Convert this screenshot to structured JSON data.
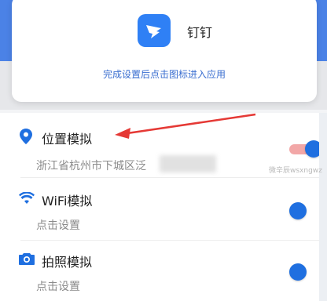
{
  "popup": {
    "app_name": "钉钉",
    "hint": "完成设置后点击图标进入应用"
  },
  "rows": [
    {
      "title": "位置模拟",
      "subtitle": "浙江省杭州市下城区泛",
      "icon": "location-pin-icon",
      "toggle_on": true
    },
    {
      "title": "WiFi模拟",
      "subtitle": "点击设置",
      "icon": "wifi-icon",
      "toggle_on": true
    },
    {
      "title": "拍照模拟",
      "subtitle": "点击设置",
      "icon": "camera-icon",
      "toggle_on": true
    }
  ],
  "watermark": "微辛辰wsxngwz",
  "colors": {
    "accent": "#1f6fe0",
    "brand_band": "#4b82e6",
    "arrow": "#e53935",
    "toggle_track_on": "#f2a7a7"
  }
}
